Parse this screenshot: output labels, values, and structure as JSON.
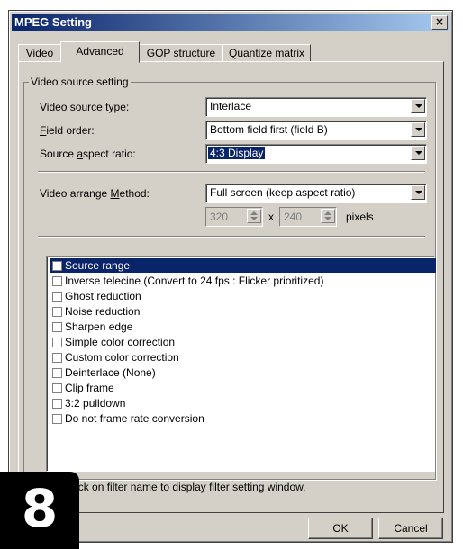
{
  "window": {
    "title": "MPEG Setting",
    "close_label": "×"
  },
  "tabs": [
    {
      "label": "Video",
      "active": false
    },
    {
      "label": "Advanced",
      "active": true
    },
    {
      "label": "GOP structure",
      "active": false
    },
    {
      "label": "Quantize matrix",
      "active": false
    }
  ],
  "group": {
    "label": "Video source setting"
  },
  "fields": {
    "source_type": {
      "label": "Video source type:",
      "value": "Interlace"
    },
    "field_order": {
      "label": "Field order:",
      "value": "Bottom field first (field B)"
    },
    "aspect_ratio": {
      "label": "Source aspect ratio:",
      "value": "4:3 Display"
    },
    "arrange_method": {
      "label": "Video arrange Method:",
      "value": "Full screen (keep aspect ratio)"
    }
  },
  "size": {
    "width": "320",
    "height": "240",
    "x_sep": "x",
    "unit": "pixels"
  },
  "filters": [
    "Source range",
    "Inverse telecine (Convert to 24 fps : Flicker prioritized)",
    "Ghost reduction",
    "Noise reduction",
    "Sharpen edge",
    "Simple color correction",
    "Custom color correction",
    "Deinterlace (None)",
    "Clip frame",
    "3:2 pulldown",
    "Do not frame rate conversion"
  ],
  "hint": "Double click on filter name to display filter setting window.",
  "buttons": {
    "ok": "OK",
    "cancel": "Cancel"
  },
  "step_badge": "8"
}
